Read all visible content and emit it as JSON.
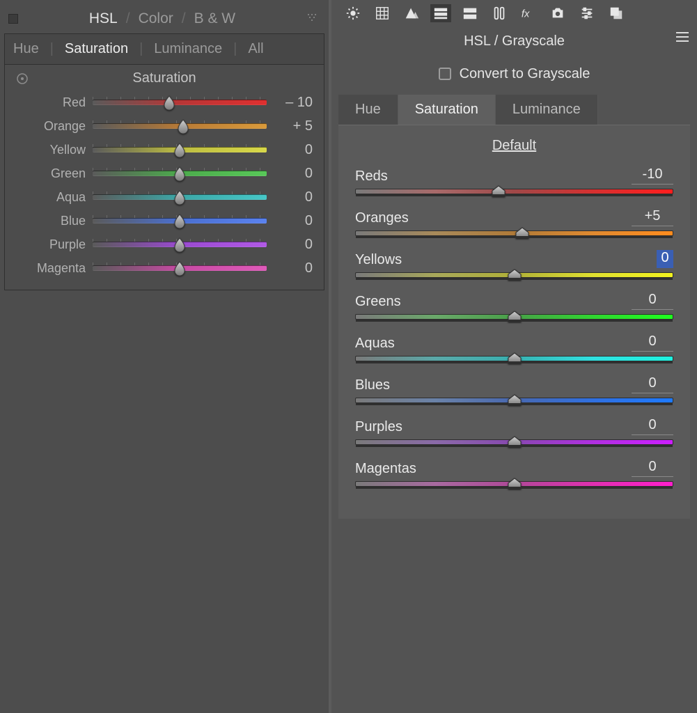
{
  "left": {
    "header": {
      "hsl": "HSL",
      "color": "Color",
      "bw": "B & W",
      "sep": "/"
    },
    "subtabs": {
      "hue": "Hue",
      "saturation": "Saturation",
      "luminance": "Luminance",
      "all": "All",
      "sep": "|"
    },
    "section_title": "Saturation",
    "sliders": [
      {
        "name": "Red",
        "value": "– 10",
        "pos": 44,
        "grad": "linear-gradient(to right,#5a5a5a,#b83636,#e03030)"
      },
      {
        "name": "Orange",
        "value": "+ 5",
        "pos": 52,
        "grad": "linear-gradient(to right,#5a5a5a,#b87a36,#d99a3a)"
      },
      {
        "name": "Yellow",
        "value": "0",
        "pos": 50,
        "grad": "linear-gradient(to right,#5a5a5a,#bdbd40,#d8d848)"
      },
      {
        "name": "Green",
        "value": "0",
        "pos": 50,
        "grad": "linear-gradient(to right,#5a5a5a,#4cab4c,#58c858)"
      },
      {
        "name": "Aqua",
        "value": "0",
        "pos": 50,
        "grad": "linear-gradient(to right,#5a5a5a,#3ca7a7,#46c7c7)"
      },
      {
        "name": "Blue",
        "value": "0",
        "pos": 50,
        "grad": "linear-gradient(to right,#5a5a5a,#4a6fd0,#5a82ef)"
      },
      {
        "name": "Purple",
        "value": "0",
        "pos": 50,
        "grad": "linear-gradient(to right,#5a5a5a,#9a4ad0,#b15ae6)"
      },
      {
        "name": "Magenta",
        "value": "0",
        "pos": 50,
        "grad": "linear-gradient(to right,#5a5a5a,#c74aa3,#df5ab9)"
      }
    ]
  },
  "right": {
    "title": "HSL / Grayscale",
    "grayscale_label": "Convert to Grayscale",
    "tabs": {
      "hue": "Hue",
      "saturation": "Saturation",
      "luminance": "Luminance"
    },
    "default_label": "Default",
    "sliders": [
      {
        "name": "Reds",
        "value": "-10",
        "pos": 45,
        "sel": false,
        "grad": "linear-gradient(to right,#7a7a7a,#a86a6a 25%,#a04848 50%,#d63030 75%,#ff1e1e)"
      },
      {
        "name": "Oranges",
        "value": "+5",
        "pos": 52.5,
        "sel": false,
        "grad": "linear-gradient(to right,#7a7a7a,#a88a5a 25%,#b07a38 50%,#e08a30 75%,#ff8c1e)"
      },
      {
        "name": "Yellows",
        "value": "0",
        "pos": 50,
        "sel": true,
        "grad": "linear-gradient(to right,#7a7a7a,#a8a85a 25%,#b0b038 50%,#e0e030 75%,#f2f21e)"
      },
      {
        "name": "Greens",
        "value": "0",
        "pos": 50,
        "sel": false,
        "grad": "linear-gradient(to right,#7a7a7a,#6aa86a 25%,#48a048 50%,#30d630 75%,#1eff1e)"
      },
      {
        "name": "Aquas",
        "value": "0",
        "pos": 50,
        "sel": false,
        "grad": "linear-gradient(to right,#7a7a7a,#5aa8a8 25%,#38b0b0 50%,#30e0e0 75%,#1ef2e0)"
      },
      {
        "name": "Blues",
        "value": "0",
        "pos": 50,
        "sel": false,
        "grad": "linear-gradient(to right,#7a7a7a,#6a82a8 25%,#4868b0 50%,#3070e0 75%,#1e7aff)"
      },
      {
        "name": "Purples",
        "value": "0",
        "pos": 50,
        "sel": false,
        "grad": "linear-gradient(to right,#7a7a7a,#8a6aa8 25%,#8848b0 50%,#b030e0 75%,#cc1eff)"
      },
      {
        "name": "Magentas",
        "value": "0",
        "pos": 50,
        "sel": false,
        "grad": "linear-gradient(to right,#7a7a7a,#a86aa0 25%,#b04898 50%,#e030b0 75%,#ff1ecc)"
      }
    ]
  }
}
